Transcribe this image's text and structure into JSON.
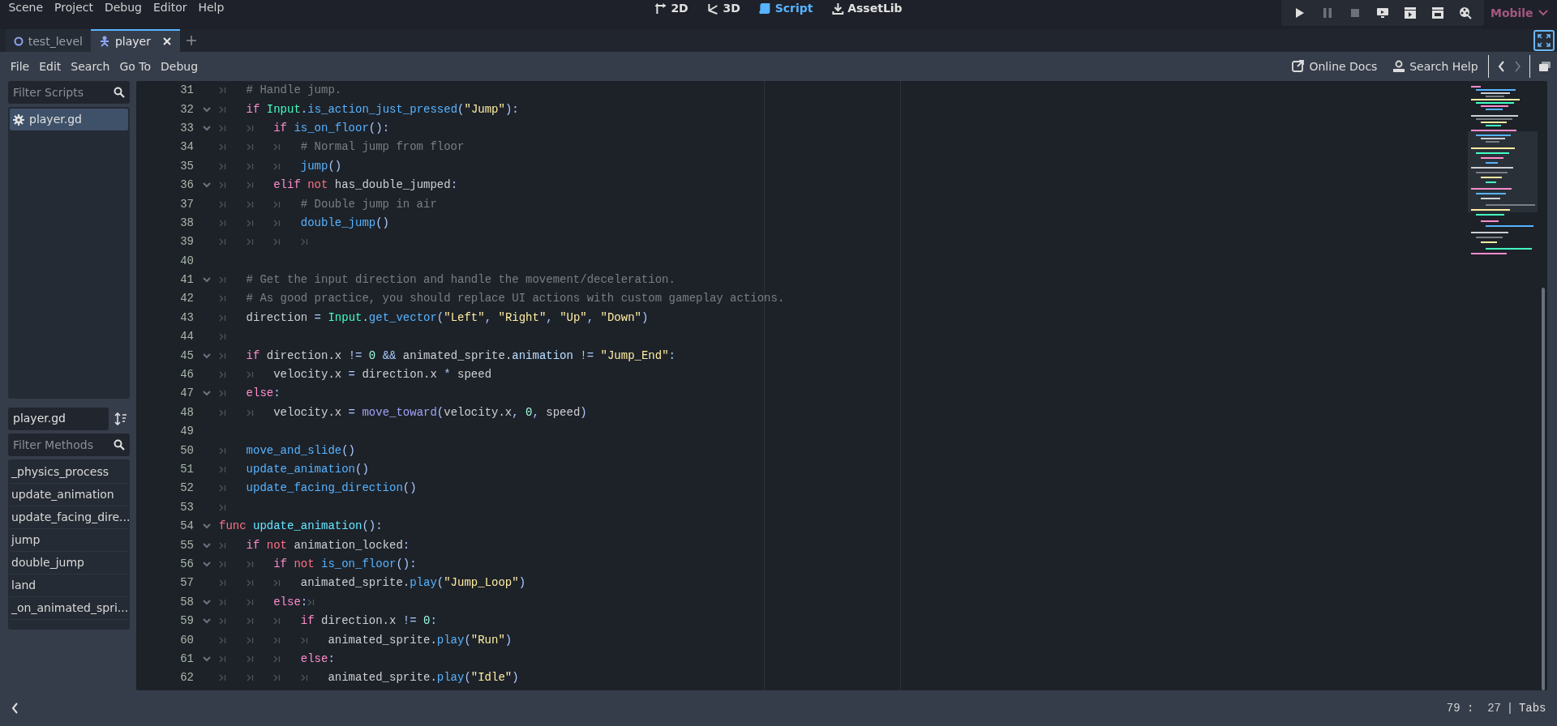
{
  "menu_bar": {
    "menus": [
      "Scene",
      "Project",
      "Debug",
      "Editor",
      "Help"
    ],
    "workspaces": [
      {
        "label": "2D",
        "kind": "canvas",
        "selected": false
      },
      {
        "label": "3D",
        "kind": "spatial",
        "selected": false
      },
      {
        "label": "Script",
        "kind": "script",
        "selected": true
      },
      {
        "label": "AssetLib",
        "kind": "assetlib",
        "selected": false
      }
    ],
    "run_buttons": [
      {
        "kind": "play",
        "disabled": false
      },
      {
        "kind": "pause",
        "disabled": true
      },
      {
        "kind": "stop",
        "disabled": true
      },
      {
        "kind": "remote",
        "disabled": false
      },
      {
        "kind": "scene",
        "disabled": false
      },
      {
        "kind": "custom",
        "disabled": false
      },
      {
        "kind": "movie",
        "disabled": false
      }
    ],
    "renderer": "Mobile"
  },
  "scene_tabs": [
    {
      "label": "test_level",
      "kind": "scene",
      "selected": false
    },
    {
      "label": "player",
      "kind": "character",
      "selected": true
    }
  ],
  "script_menu": [
    "File",
    "Edit",
    "Search",
    "Go To",
    "Debug"
  ],
  "help_buttons": [
    {
      "label": "Online Docs",
      "kind": "docs"
    },
    {
      "label": "Search Help",
      "kind": "help"
    }
  ],
  "sidebar": {
    "filter_scripts": {
      "placeholder": "Filter Scripts"
    },
    "scripts": [
      {
        "label": "player.gd",
        "selected": true
      }
    ],
    "current_script": "player.gd",
    "filter_methods": {
      "placeholder": "Filter Methods"
    },
    "methods": [
      {
        "label": "_physics_process",
        "selected": false
      },
      {
        "label": "update_animation",
        "selected": false
      },
      {
        "label": "update_facing_dire...",
        "selected": false
      },
      {
        "label": "jump",
        "selected": false
      },
      {
        "label": "double_jump",
        "selected": false
      },
      {
        "label": "land",
        "selected": false
      },
      {
        "label": "_on_animated_spri...",
        "selected": false
      }
    ]
  },
  "code_lines": [
    {
      "number": "31",
      "foldable": false,
      "tokens": [
        {
          "kind": "tab"
        },
        {
          "kind": "comment",
          "text": "# Handle jump."
        }
      ]
    },
    {
      "number": "32",
      "foldable": true,
      "tokens": [
        {
          "kind": "tab"
        },
        {
          "kind": "control",
          "text": "if "
        },
        {
          "kind": "type",
          "text": "Input"
        },
        {
          "kind": "symbol",
          "text": "."
        },
        {
          "kind": "call",
          "text": "is_action_just_pressed"
        },
        {
          "kind": "symbol",
          "text": "("
        },
        {
          "kind": "string",
          "text": "\"Jump\""
        },
        {
          "kind": "symbol",
          "text": "):"
        }
      ]
    },
    {
      "number": "33",
      "foldable": true,
      "tokens": [
        {
          "kind": "tab"
        },
        {
          "kind": "tab"
        },
        {
          "kind": "control",
          "text": "if "
        },
        {
          "kind": "call",
          "text": "is_on_floor"
        },
        {
          "kind": "symbol",
          "text": "():"
        }
      ]
    },
    {
      "number": "34",
      "foldable": false,
      "tokens": [
        {
          "kind": "tab"
        },
        {
          "kind": "tab"
        },
        {
          "kind": "tab"
        },
        {
          "kind": "comment",
          "text": "# Normal jump from floor"
        }
      ]
    },
    {
      "number": "35",
      "foldable": false,
      "tokens": [
        {
          "kind": "tab"
        },
        {
          "kind": "tab"
        },
        {
          "kind": "tab"
        },
        {
          "kind": "call",
          "text": "jump"
        },
        {
          "kind": "symbol",
          "text": "()"
        }
      ]
    },
    {
      "number": "36",
      "foldable": true,
      "tokens": [
        {
          "kind": "tab"
        },
        {
          "kind": "tab"
        },
        {
          "kind": "control",
          "text": "elif "
        },
        {
          "kind": "keyword",
          "text": "not"
        },
        {
          "kind": "plain",
          "text": " has_double_jumped"
        },
        {
          "kind": "symbol",
          "text": ":"
        }
      ]
    },
    {
      "number": "37",
      "foldable": false,
      "tokens": [
        {
          "kind": "tab"
        },
        {
          "kind": "tab"
        },
        {
          "kind": "tab"
        },
        {
          "kind": "comment",
          "text": "# Double jump in air"
        }
      ]
    },
    {
      "number": "38",
      "foldable": false,
      "tokens": [
        {
          "kind": "tab"
        },
        {
          "kind": "tab"
        },
        {
          "kind": "tab"
        },
        {
          "kind": "call",
          "text": "double_jump"
        },
        {
          "kind": "symbol",
          "text": "()"
        }
      ]
    },
    {
      "number": "39",
      "foldable": false,
      "tokens": [
        {
          "kind": "tab"
        },
        {
          "kind": "tab"
        },
        {
          "kind": "tab"
        },
        {
          "kind": "tab"
        }
      ]
    },
    {
      "number": "40",
      "foldable": false
    },
    {
      "number": "41",
      "foldable": true,
      "tokens": [
        {
          "kind": "tab"
        },
        {
          "kind": "comment",
          "text": "# Get the input direction and handle the movement/deceleration."
        }
      ]
    },
    {
      "number": "42",
      "foldable": false,
      "tokens": [
        {
          "kind": "tab"
        },
        {
          "kind": "comment",
          "text": "# As good practice, you should replace UI actions with custom gameplay actions."
        }
      ]
    },
    {
      "number": "43",
      "foldable": false,
      "tokens": [
        {
          "kind": "tab"
        },
        {
          "kind": "plain",
          "text": "direction "
        },
        {
          "kind": "symbol",
          "text": "= "
        },
        {
          "kind": "type",
          "text": "Input"
        },
        {
          "kind": "symbol",
          "text": "."
        },
        {
          "kind": "call",
          "text": "get_vector"
        },
        {
          "kind": "symbol",
          "text": "("
        },
        {
          "kind": "string",
          "text": "\"Left\""
        },
        {
          "kind": "symbol",
          "text": ", "
        },
        {
          "kind": "string",
          "text": "\"Right\""
        },
        {
          "kind": "symbol",
          "text": ", "
        },
        {
          "kind": "string",
          "text": "\"Up\""
        },
        {
          "kind": "symbol",
          "text": ", "
        },
        {
          "kind": "string",
          "text": "\"Down\""
        },
        {
          "kind": "symbol",
          "text": ")"
        }
      ]
    },
    {
      "number": "44",
      "foldable": false,
      "tokens": [
        {
          "kind": "tab"
        }
      ]
    },
    {
      "number": "45",
      "foldable": true,
      "tokens": [
        {
          "kind": "tab"
        },
        {
          "kind": "control",
          "text": "if"
        },
        {
          "kind": "plain",
          "text": " direction.x "
        },
        {
          "kind": "symbol",
          "text": "!= "
        },
        {
          "kind": "number",
          "text": "0"
        },
        {
          "kind": "symbol",
          "text": " &&"
        },
        {
          "kind": "plain",
          "text": " animated_sprite."
        },
        {
          "kind": "member",
          "text": "animation"
        },
        {
          "kind": "symbol",
          "text": " != "
        },
        {
          "kind": "string",
          "text": "\"Jump_End\""
        },
        {
          "kind": "symbol",
          "text": ":"
        }
      ]
    },
    {
      "number": "46",
      "foldable": false,
      "tokens": [
        {
          "kind": "tab"
        },
        {
          "kind": "tab"
        },
        {
          "kind": "plain",
          "text": "velocity.x "
        },
        {
          "kind": "symbol",
          "text": "="
        },
        {
          "kind": "plain",
          "text": " direction.x "
        },
        {
          "kind": "symbol",
          "text": "*"
        },
        {
          "kind": "plain",
          "text": " speed"
        }
      ]
    },
    {
      "number": "47",
      "foldable": true,
      "tokens": [
        {
          "kind": "tab"
        },
        {
          "kind": "control",
          "text": "else"
        },
        {
          "kind": "symbol",
          "text": ":"
        }
      ]
    },
    {
      "number": "48",
      "foldable": false,
      "tokens": [
        {
          "kind": "tab"
        },
        {
          "kind": "tab"
        },
        {
          "kind": "plain",
          "text": "velocity.x "
        },
        {
          "kind": "symbol",
          "text": "= "
        },
        {
          "kind": "global",
          "text": "move_toward"
        },
        {
          "kind": "symbol",
          "text": "("
        },
        {
          "kind": "plain",
          "text": "velocity.x"
        },
        {
          "kind": "symbol",
          "text": ", "
        },
        {
          "kind": "number",
          "text": "0"
        },
        {
          "kind": "symbol",
          "text": ", "
        },
        {
          "kind": "plain",
          "text": "speed"
        },
        {
          "kind": "symbol",
          "text": ")"
        }
      ]
    },
    {
      "number": "49",
      "foldable": false
    },
    {
      "number": "50",
      "foldable": false,
      "tokens": [
        {
          "kind": "tab"
        },
        {
          "kind": "call",
          "text": "move_and_slide"
        },
        {
          "kind": "symbol",
          "text": "()"
        }
      ]
    },
    {
      "number": "51",
      "foldable": false,
      "tokens": [
        {
          "kind": "tab"
        },
        {
          "kind": "call",
          "text": "update_animation"
        },
        {
          "kind": "symbol",
          "text": "()"
        }
      ]
    },
    {
      "number": "52",
      "foldable": false,
      "tokens": [
        {
          "kind": "tab"
        },
        {
          "kind": "call",
          "text": "update_facing_direction"
        },
        {
          "kind": "symbol",
          "text": "()"
        }
      ]
    },
    {
      "number": "53",
      "foldable": false,
      "tokens": [
        {
          "kind": "tab"
        }
      ]
    },
    {
      "number": "54",
      "foldable": true,
      "tokens": [
        {
          "kind": "keyword",
          "text": "func "
        },
        {
          "kind": "definition",
          "text": "update_animation"
        },
        {
          "kind": "symbol",
          "text": "():"
        }
      ]
    },
    {
      "number": "55",
      "foldable": true,
      "tokens": [
        {
          "kind": "tab"
        },
        {
          "kind": "control",
          "text": "if "
        },
        {
          "kind": "keyword",
          "text": "not"
        },
        {
          "kind": "plain",
          "text": " animation_locked"
        },
        {
          "kind": "symbol",
          "text": ":"
        }
      ]
    },
    {
      "number": "56",
      "foldable": true,
      "tokens": [
        {
          "kind": "tab"
        },
        {
          "kind": "tab"
        },
        {
          "kind": "control",
          "text": "if "
        },
        {
          "kind": "keyword",
          "text": "not "
        },
        {
          "kind": "call",
          "text": "is_on_floor"
        },
        {
          "kind": "symbol",
          "text": "():"
        }
      ]
    },
    {
      "number": "57",
      "foldable": false,
      "tokens": [
        {
          "kind": "tab"
        },
        {
          "kind": "tab"
        },
        {
          "kind": "tab"
        },
        {
          "kind": "plain",
          "text": "animated_sprite."
        },
        {
          "kind": "call",
          "text": "play"
        },
        {
          "kind": "symbol",
          "text": "("
        },
        {
          "kind": "string",
          "text": "\"Jump_Loop\""
        },
        {
          "kind": "symbol",
          "text": ")"
        }
      ]
    },
    {
      "number": "58",
      "foldable": true,
      "tokens": [
        {
          "kind": "tab"
        },
        {
          "kind": "tab"
        },
        {
          "kind": "control",
          "text": "else"
        },
        {
          "kind": "symbol",
          "text": ":"
        },
        {
          "kind": "tab"
        }
      ]
    },
    {
      "number": "59",
      "foldable": true,
      "tokens": [
        {
          "kind": "tab"
        },
        {
          "kind": "tab"
        },
        {
          "kind": "tab"
        },
        {
          "kind": "control",
          "text": "if"
        },
        {
          "kind": "plain",
          "text": " direction.x "
        },
        {
          "kind": "symbol",
          "text": "!= "
        },
        {
          "kind": "number",
          "text": "0"
        },
        {
          "kind": "symbol",
          "text": ":"
        }
      ]
    },
    {
      "number": "60",
      "foldable": false,
      "tokens": [
        {
          "kind": "tab"
        },
        {
          "kind": "tab"
        },
        {
          "kind": "tab"
        },
        {
          "kind": "tab"
        },
        {
          "kind": "plain",
          "text": "animated_sprite."
        },
        {
          "kind": "call",
          "text": "play"
        },
        {
          "kind": "symbol",
          "text": "("
        },
        {
          "kind": "string",
          "text": "\"Run\""
        },
        {
          "kind": "symbol",
          "text": ")"
        }
      ]
    },
    {
      "number": "61",
      "foldable": true,
      "tokens": [
        {
          "kind": "tab"
        },
        {
          "kind": "tab"
        },
        {
          "kind": "tab"
        },
        {
          "kind": "control",
          "text": "else"
        },
        {
          "kind": "symbol",
          "text": ":"
        }
      ]
    },
    {
      "number": "62",
      "foldable": false,
      "tokens": [
        {
          "kind": "tab"
        },
        {
          "kind": "tab"
        },
        {
          "kind": "tab"
        },
        {
          "kind": "tab"
        },
        {
          "kind": "plain",
          "text": "animated_sprite."
        },
        {
          "kind": "call",
          "text": "play"
        },
        {
          "kind": "symbol",
          "text": "("
        },
        {
          "kind": "string",
          "text": "\"Idle\""
        },
        {
          "kind": "symbol",
          "text": ")"
        }
      ]
    }
  ],
  "status_bar": {
    "position": "79 :  27",
    "separator": "|",
    "indentation": "Tabs"
  }
}
